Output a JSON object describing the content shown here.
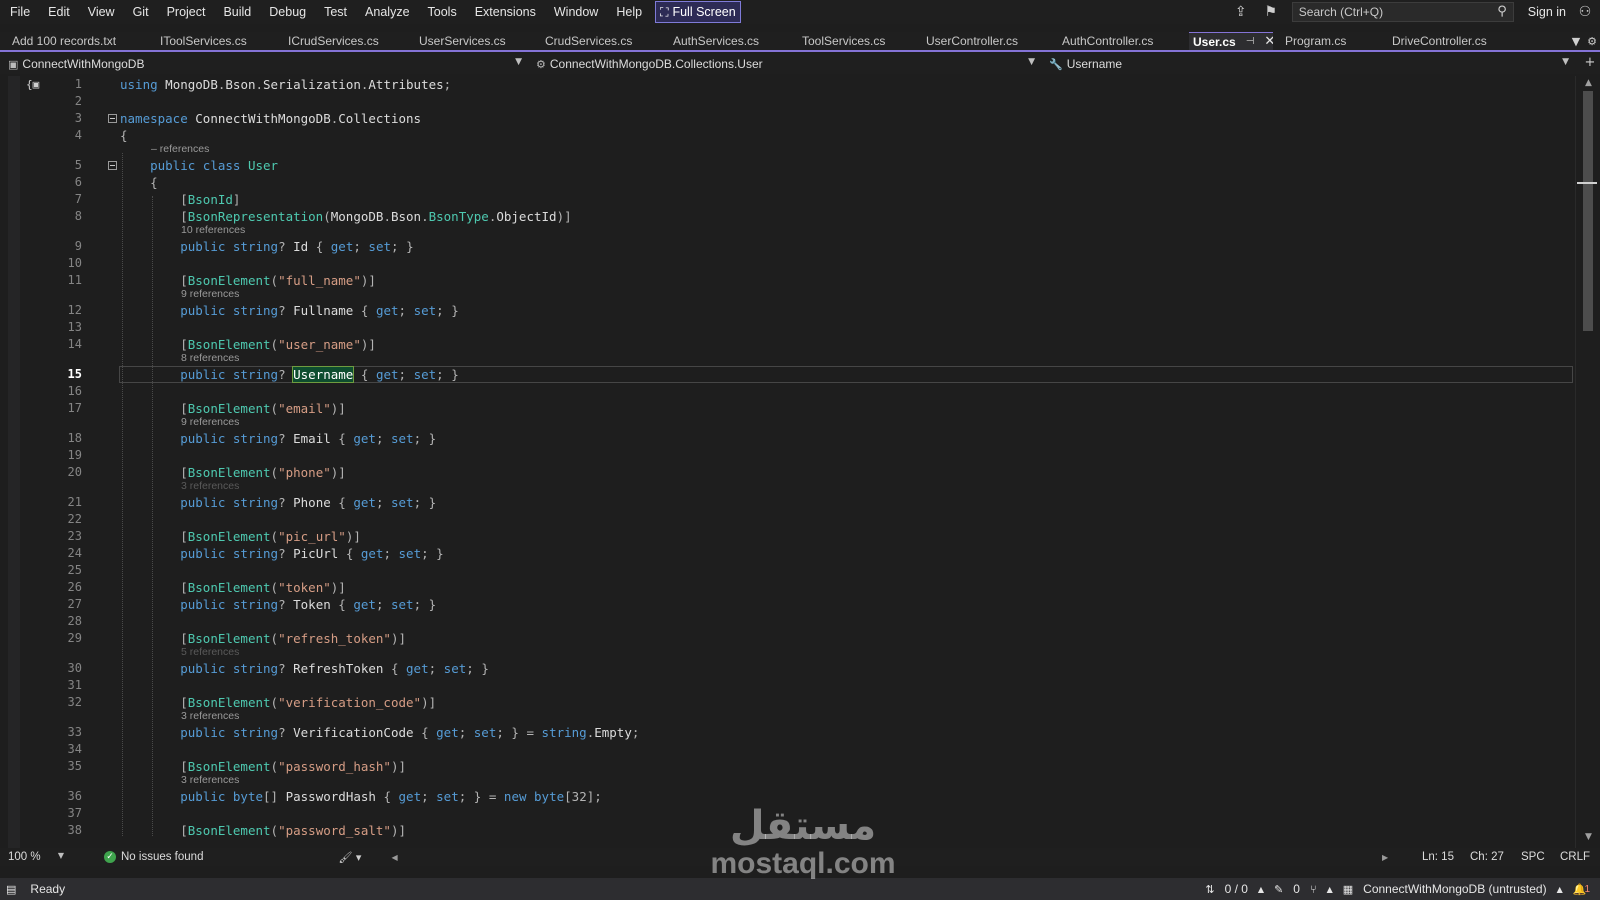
{
  "menubar": {
    "items": [
      "File",
      "Edit",
      "View",
      "Git",
      "Project",
      "Build",
      "Debug",
      "Test",
      "Analyze",
      "Tools",
      "Extensions",
      "Window",
      "Help"
    ],
    "fullscreen_label": "Full Screen",
    "search_placeholder": "Search (Ctrl+Q)",
    "signin_label": "Sign in"
  },
  "tabs": {
    "items": [
      "Add 100 records.txt",
      "IToolServices.cs",
      "ICrudServices.cs",
      "UserServices.cs",
      "CrudServices.cs",
      "AuthServices.cs",
      "ToolServices.cs",
      "UserController.cs",
      "AuthController.cs",
      "User.cs",
      "Program.cs",
      "DriveController.cs"
    ],
    "active": "User.cs"
  },
  "navbar": {
    "project": "ConnectWithMongoDB",
    "type": "ConnectWithMongoDB.Collections.User",
    "member": "Username"
  },
  "code": {
    "lines": [
      {
        "n": "1",
        "t": "using MongoDB.Bson.Serialization.Attributes;"
      },
      {
        "n": "2",
        "t": ""
      },
      {
        "n": "3",
        "t": "namespace ConnectWithMongoDB.Collections"
      },
      {
        "n": "4",
        "t": "{"
      },
      {
        "n": "5",
        "t": "    public class User",
        "lens": "– references"
      },
      {
        "n": "6",
        "t": "    {"
      },
      {
        "n": "7",
        "t": "        [BsonId]"
      },
      {
        "n": "8",
        "t": "        [BsonRepresentation(MongoDB.Bson.BsonType.ObjectId)]"
      },
      {
        "n": "9",
        "t": "        public string? Id { get; set; }",
        "lens": "10 references"
      },
      {
        "n": "10",
        "t": ""
      },
      {
        "n": "11",
        "t": "        [BsonElement(\"full_name\")]"
      },
      {
        "n": "12",
        "t": "        public string? Fullname { get; set; }",
        "lens": "9 references"
      },
      {
        "n": "13",
        "t": ""
      },
      {
        "n": "14",
        "t": "        [BsonElement(\"user_name\")]"
      },
      {
        "n": "15",
        "t": "        public string? Username { get; set; }",
        "lens": "8 references"
      },
      {
        "n": "16",
        "t": ""
      },
      {
        "n": "17",
        "t": "        [BsonElement(\"email\")]"
      },
      {
        "n": "18",
        "t": "        public string? Email { get; set; }",
        "lens": "9 references"
      },
      {
        "n": "19",
        "t": ""
      },
      {
        "n": "20",
        "t": "        [BsonElement(\"phone\")]"
      },
      {
        "n": "21",
        "t": "        public string? Phone { get; set; }",
        "lens": "3 references",
        "lens_faded": true
      },
      {
        "n": "22",
        "t": ""
      },
      {
        "n": "23",
        "t": "        [BsonElement(\"pic_url\")]"
      },
      {
        "n": "24",
        "t": "        public string? PicUrl { get; set; }"
      },
      {
        "n": "25",
        "t": ""
      },
      {
        "n": "26",
        "t": "        [BsonElement(\"token\")]"
      },
      {
        "n": "27",
        "t": "        public string? Token { get; set; }"
      },
      {
        "n": "28",
        "t": ""
      },
      {
        "n": "29",
        "t": "        [BsonElement(\"refresh_token\")]"
      },
      {
        "n": "30",
        "t": "        public string? RefreshToken { get; set; }",
        "lens": "5 references",
        "lens_faded": true
      },
      {
        "n": "31",
        "t": ""
      },
      {
        "n": "32",
        "t": "        [BsonElement(\"verification_code\")]"
      },
      {
        "n": "33",
        "t": "        public string? VerificationCode { get; set; } = string.Empty;",
        "lens": "3 references"
      },
      {
        "n": "34",
        "t": ""
      },
      {
        "n": "35",
        "t": "        [BsonElement(\"password_hash\")]"
      },
      {
        "n": "36",
        "t": "        public byte[] PasswordHash { get; set; } = new byte[32];",
        "lens": "3 references"
      },
      {
        "n": "37",
        "t": ""
      },
      {
        "n": "38",
        "t": "        [BsonElement(\"password_salt\")]"
      }
    ],
    "current_line": "15",
    "selected_word": "Username"
  },
  "editorstrip": {
    "zoom": "100 %",
    "issues": "No issues found",
    "ln": "Ln: 15",
    "ch": "Ch: 27",
    "spc": "SPC",
    "crlf": "CRLF"
  },
  "statusbar": {
    "ready": "Ready",
    "updown": "0 / 0",
    "pencil_count": "0",
    "repo": "ConnectWithMongoDB (untrusted)",
    "notifications": "1"
  },
  "watermark": {
    "arabic": "مستقل",
    "latin": "mostaql.com"
  },
  "colors": {
    "keyword": "#569cd6",
    "type": "#4ec9b0",
    "string": "#d69d85",
    "accent": "#8473d6",
    "background": "#1e1e1e"
  }
}
